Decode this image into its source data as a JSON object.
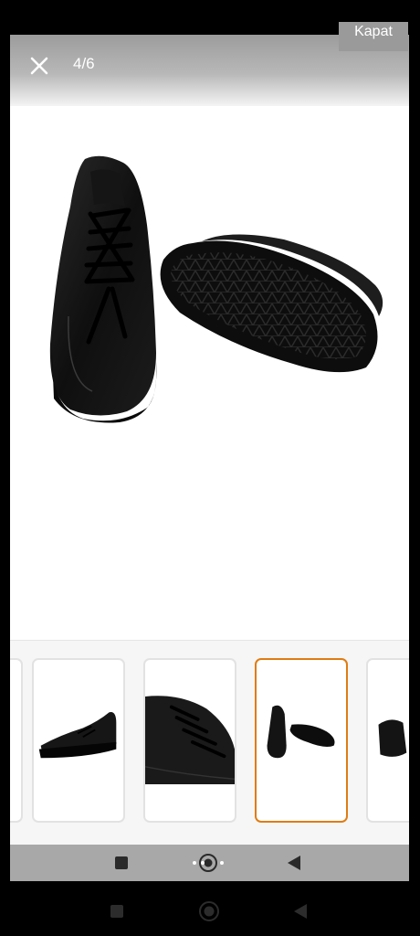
{
  "window": {
    "close_tab_label": "Kapat"
  },
  "viewer": {
    "counter": "4/6",
    "current_index": 4,
    "total_images": 6,
    "accent_color": "#e07c12"
  },
  "icons": {
    "close": "close-icon",
    "square": "recents-icon",
    "circle": "home-icon",
    "back": "back-icon"
  },
  "thumbnails": [
    {
      "name": "thumb-partial-left",
      "active": false
    },
    {
      "name": "thumb-shoe-side",
      "active": false
    },
    {
      "name": "thumb-shoe-laces",
      "active": false
    },
    {
      "name": "thumb-shoe-pair",
      "active": true
    },
    {
      "name": "thumb-shoe-back",
      "active": false
    }
  ]
}
